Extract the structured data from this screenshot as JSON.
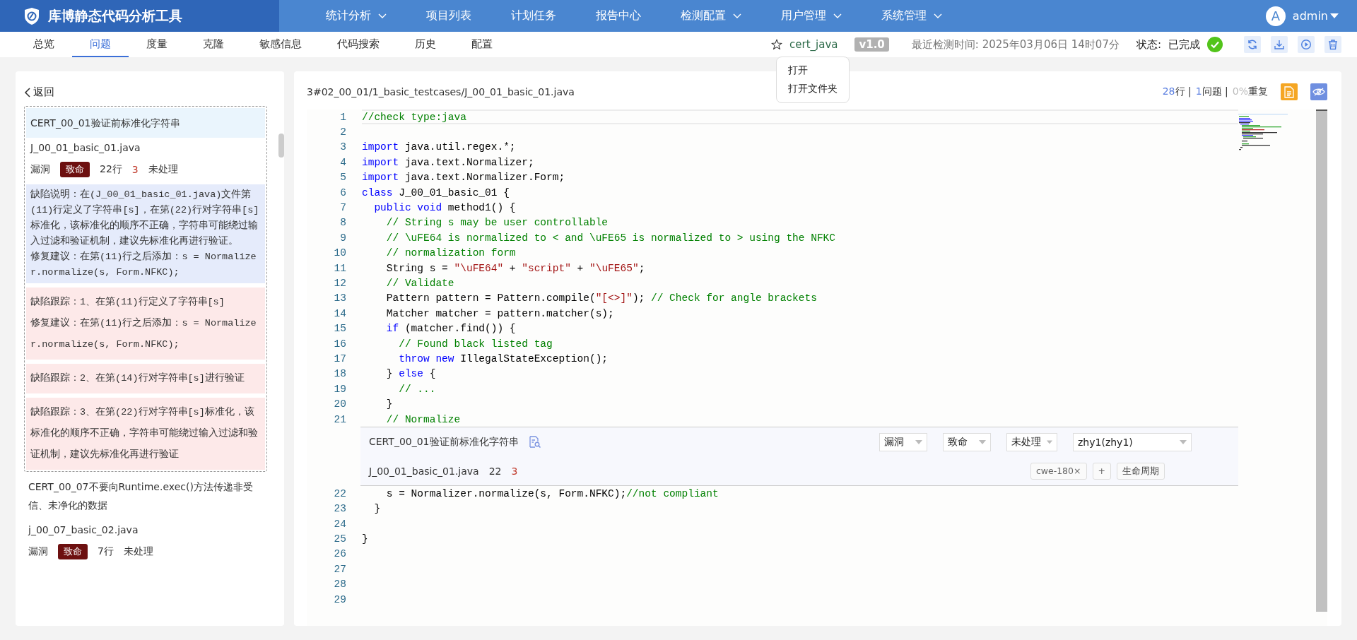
{
  "app": {
    "title": "库博静态代码分析工具"
  },
  "nav": [
    {
      "label": "统计分析",
      "dropdown": true
    },
    {
      "label": "项目列表",
      "dropdown": false
    },
    {
      "label": "计划任务",
      "dropdown": false
    },
    {
      "label": "报告中心",
      "dropdown": false
    },
    {
      "label": "检测配置",
      "dropdown": true
    },
    {
      "label": "用户管理",
      "dropdown": true
    },
    {
      "label": "系统管理",
      "dropdown": true
    }
  ],
  "user": {
    "avatar": "A",
    "name": "admin"
  },
  "tabs": [
    {
      "label": "总览",
      "selected": false
    },
    {
      "label": "问题",
      "selected": true
    },
    {
      "label": "度量",
      "selected": false
    },
    {
      "label": "克隆",
      "selected": false
    },
    {
      "label": "敏感信息",
      "selected": false
    },
    {
      "label": "代码搜索",
      "selected": false
    },
    {
      "label": "历史",
      "selected": false
    },
    {
      "label": "配置",
      "selected": false
    }
  ],
  "project": {
    "starred": false,
    "name": "cert_java",
    "version": "v1.0",
    "last_scan": "最近检测时间: 2025年03月06日 14时07分",
    "status_label": "状态:",
    "status": "已完成",
    "done": true
  },
  "context_menu": {
    "items": [
      "打开",
      "打开文件夹"
    ]
  },
  "issues_panel": {
    "back": "返回",
    "issues": [
      {
        "selected": true,
        "title": "CERT_00_01验证前标准化字符串",
        "file": "J_00_01_basic_01.java",
        "type": "漏洞",
        "severity": "致命",
        "line": "22行",
        "count": "3",
        "status": "未处理",
        "description": "缺陷说明：在(J_00_01_basic_01.java)文件第(11)行定义了字符串[s]，在第(22)行对字符串[s]标准化，该标准化的顺序不正确，字符串可能绕过输入过滤和验证机制，建议先标准化再进行验证。",
        "fix": "修复建议：在第(11)行之后添加：s = Normalizer.normalize(s, Form.NFKC);",
        "traces": [
          {
            "text": "缺陷跟踪：1、在第(11)行定义了字符串[s]",
            "fix": "修复建议：在第(11)行之后添加：s = Normalizer.normalize(s, Form.NFKC);"
          },
          {
            "text": "缺陷跟踪：2、在第(14)行对字符串[s]进行验证"
          },
          {
            "text": "缺陷跟踪：3、在第(22)行对字符串[s]标准化，该标准化的顺序不正确，字符串可能绕过输入过滤和验证机制，建议先标准化再进行验证"
          }
        ]
      },
      {
        "selected": false,
        "title": "CERT_00_07不要向Runtime.exec()方法传递非受信、未净化的数据",
        "file": "j_00_07_basic_02.java",
        "type": "漏洞",
        "severity": "致命",
        "line": "7行",
        "status": "未处理"
      }
    ]
  },
  "file": {
    "path": "3#02_00_01/1_basic_testcases/J_00_01_basic_01.java",
    "lines": "28",
    "lines_unit": "行 |",
    "issues": "1",
    "issues_unit": "问题 |",
    "dup": "0%",
    "dup_unit": "重复"
  },
  "code": {
    "lines": [
      {
        "kind": "code",
        "number": "1",
        "current": true,
        "tokens": [
          {
            "kind": "comment",
            "text": "//check type:java"
          }
        ]
      },
      {
        "kind": "code",
        "number": "2",
        "current": false
      },
      {
        "kind": "code",
        "number": "3",
        "current": false,
        "tokens": [
          {
            "kind": "keyword",
            "text": "import"
          },
          {
            "kind": "plain",
            "text": " java.util.regex.*;"
          }
        ]
      },
      {
        "kind": "code",
        "number": "4",
        "current": false,
        "tokens": [
          {
            "kind": "keyword",
            "text": "import"
          },
          {
            "kind": "plain",
            "text": " java.text.Normalizer;"
          }
        ]
      },
      {
        "kind": "code",
        "number": "5",
        "current": false,
        "tokens": [
          {
            "kind": "keyword",
            "text": "import"
          },
          {
            "kind": "plain",
            "text": " java.text.Normalizer.Form;"
          }
        ]
      },
      {
        "kind": "code",
        "number": "6",
        "current": false,
        "tokens": [
          {
            "kind": "keyword",
            "text": "class"
          },
          {
            "kind": "plain",
            "text": " J_00_01_basic_01 {"
          }
        ]
      },
      {
        "kind": "code",
        "number": "7",
        "current": false,
        "tokens": [
          {
            "kind": "keyword",
            "text": "  public void"
          },
          {
            "kind": "plain",
            "text": " method1() {"
          }
        ]
      },
      {
        "kind": "code",
        "number": "8",
        "current": false,
        "tokens": [
          {
            "kind": "comment",
            "text": "    // String s may be user controllable"
          }
        ]
      },
      {
        "kind": "code",
        "number": "9",
        "current": false,
        "tokens": [
          {
            "kind": "comment",
            "text": "    // \\uFE64 is normalized to < and \\uFE65 is normalized to > using the NFKC"
          }
        ]
      },
      {
        "kind": "code",
        "number": "10",
        "current": false,
        "tokens": [
          {
            "kind": "comment",
            "text": "    // normalization form"
          }
        ]
      },
      {
        "kind": "code",
        "number": "11",
        "current": false,
        "tokens": [
          {
            "kind": "plain",
            "text": "    String s = "
          },
          {
            "kind": "string",
            "text": "\"\\uFE64\""
          },
          {
            "kind": "plain",
            "text": " + "
          },
          {
            "kind": "string",
            "text": "\"script\""
          },
          {
            "kind": "plain",
            "text": " + "
          },
          {
            "kind": "string",
            "text": "\"\\uFE65\""
          },
          {
            "kind": "plain",
            "text": ";"
          }
        ]
      },
      {
        "kind": "code",
        "number": "12",
        "current": false,
        "tokens": [
          {
            "kind": "comment",
            "text": "    // Validate"
          }
        ]
      },
      {
        "kind": "code",
        "number": "13",
        "current": false,
        "tokens": [
          {
            "kind": "plain",
            "text": "    Pattern pattern = Pattern.compile("
          },
          {
            "kind": "string",
            "text": "\"[<>]\""
          },
          {
            "kind": "plain",
            "text": "); "
          },
          {
            "kind": "comment",
            "text": "// Check for angle brackets"
          }
        ]
      },
      {
        "kind": "code",
        "number": "14",
        "current": false,
        "tokens": [
          {
            "kind": "plain",
            "text": "    Matcher matcher = pattern.matcher(s);"
          }
        ]
      },
      {
        "kind": "code",
        "number": "15",
        "current": false,
        "tokens": [
          {
            "kind": "keyword",
            "text": "    if"
          },
          {
            "kind": "plain",
            "text": " (matcher.find()) {"
          }
        ]
      },
      {
        "kind": "code",
        "number": "16",
        "current": false,
        "tokens": [
          {
            "kind": "comment",
            "text": "      // Found black listed tag"
          }
        ]
      },
      {
        "kind": "code",
        "number": "17",
        "current": false,
        "tokens": [
          {
            "kind": "keyword",
            "text": "      throw new"
          },
          {
            "kind": "plain",
            "text": " IllegalStateException();"
          }
        ]
      },
      {
        "kind": "code",
        "number": "18",
        "current": false,
        "tokens": [
          {
            "kind": "plain",
            "text": "    } "
          },
          {
            "kind": "keyword",
            "text": "else"
          },
          {
            "kind": "plain",
            "text": " {"
          }
        ]
      },
      {
        "kind": "code",
        "number": "19",
        "current": false,
        "tokens": [
          {
            "kind": "comment",
            "text": "      // ..."
          }
        ]
      },
      {
        "kind": "code",
        "number": "20",
        "current": false,
        "tokens": [
          {
            "kind": "plain",
            "text": "    }"
          }
        ]
      },
      {
        "kind": "code",
        "number": "21",
        "current": false,
        "tokens": [
          {
            "kind": "comment",
            "text": "    // Normalize"
          }
        ]
      },
      {
        "kind": "issue",
        "title": "CERT_00_01验证前标准化字符串",
        "type": "漏洞",
        "severity": "致命",
        "status": "未处理",
        "assignee": "zhy1(zhy1)",
        "file": "J_00_01_basic_01.java",
        "line": "22",
        "count": "3",
        "tags": [
          "cwe-180×"
        ],
        "add": "+",
        "lifecycle": "生命周期"
      },
      {
        "kind": "code",
        "number": "22",
        "current": false,
        "tokens": [
          {
            "kind": "plain",
            "text": "    s = Normalizer.normalize(s, Form.NFKC);"
          },
          {
            "kind": "comment",
            "text": "//not compliant"
          }
        ]
      },
      {
        "kind": "code",
        "number": "23",
        "current": false,
        "tokens": [
          {
            "kind": "plain",
            "text": "  }"
          }
        ]
      },
      {
        "kind": "code",
        "number": "24",
        "current": false
      },
      {
        "kind": "code",
        "number": "25",
        "current": false,
        "tokens": [
          {
            "kind": "plain",
            "text": "}"
          }
        ]
      },
      {
        "kind": "code",
        "number": "26",
        "current": false
      },
      {
        "kind": "code",
        "number": "27",
        "current": false
      },
      {
        "kind": "code",
        "number": "28",
        "current": false
      },
      {
        "kind": "code",
        "number": "29",
        "current": false
      }
    ]
  }
}
